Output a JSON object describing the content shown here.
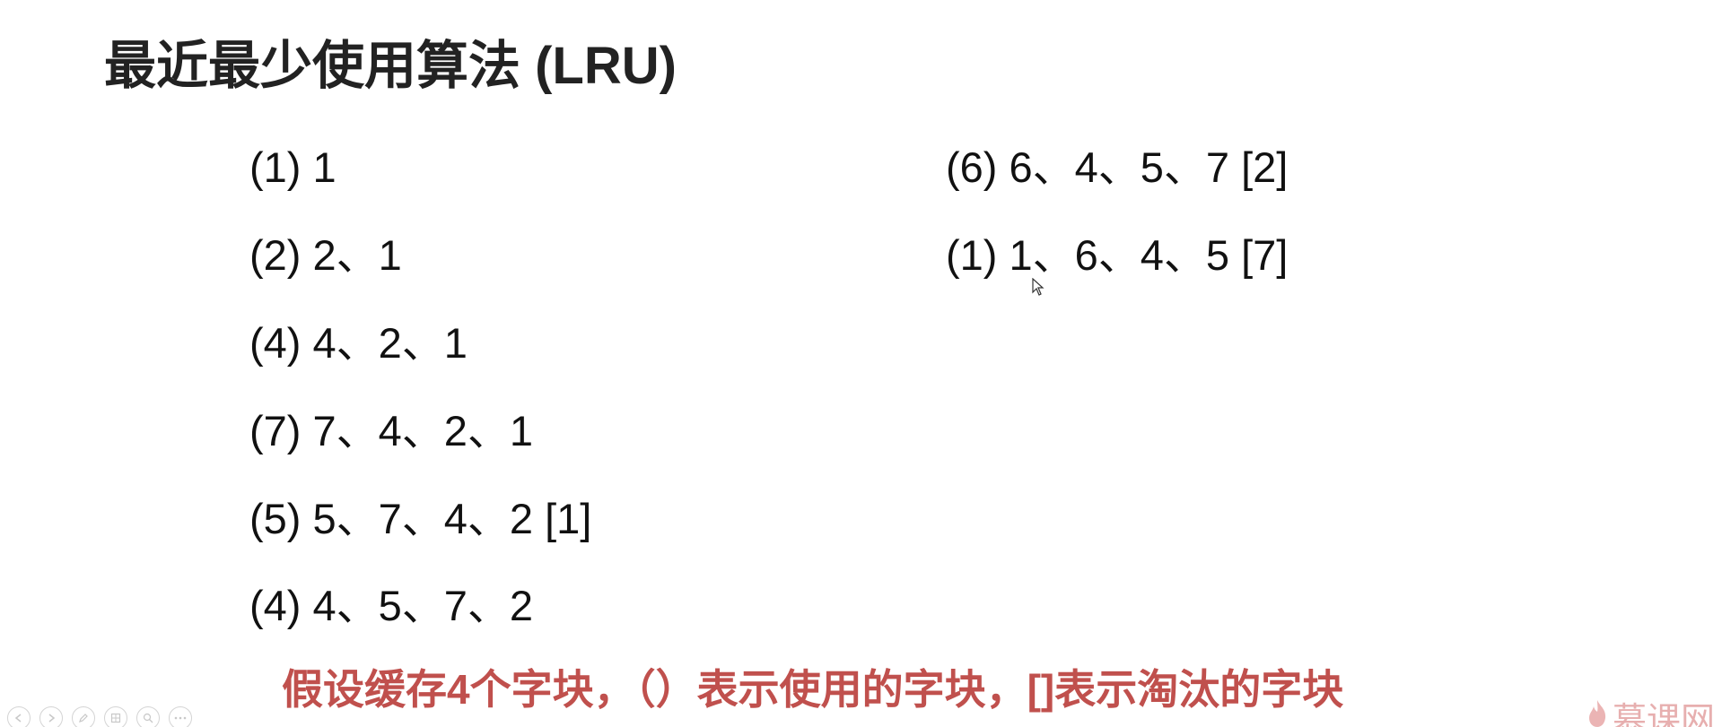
{
  "slide": {
    "title": "最近最少使用算法 (LRU)"
  },
  "steps_left": [
    "(1) 1",
    "(2) 2、1",
    "(4) 4、2、1",
    "(7) 7、4、2、1",
    "(5) 5、7、4、2 [1]",
    "(4) 4、5、7、2"
  ],
  "steps_right": [
    "(6) 6、4、5、7 [2]",
    "(1) 1、6、4、5 [7]"
  ],
  "note": {
    "text": "假设缓存4个字块，（）表示使用的字块，[]表示淘汰的字块",
    "color": "#c0504d"
  },
  "toolbar": {
    "buttons": [
      "prev-icon",
      "next-icon",
      "pen-icon",
      "grid-icon",
      "zoom-icon",
      "more-icon"
    ]
  },
  "watermark": {
    "logo_text": "慕课网",
    "icon": "flame-icon"
  }
}
